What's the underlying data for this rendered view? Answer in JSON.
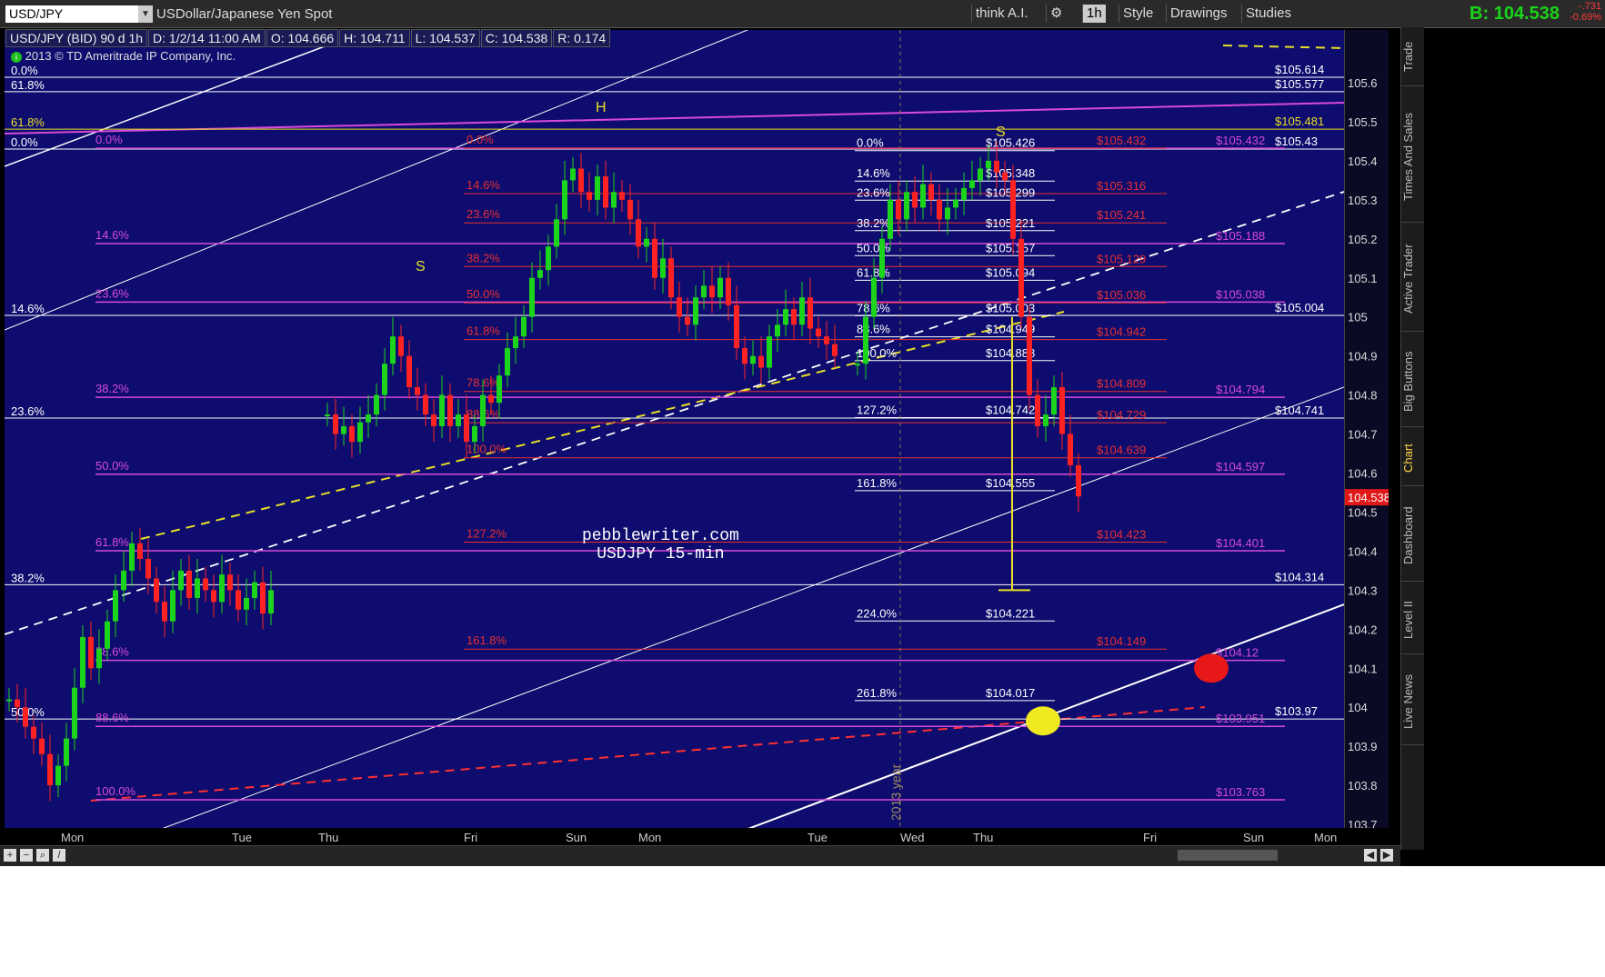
{
  "toolbar": {
    "symbol": "USD/JPY",
    "description": "USDollar/Japanese Yen Spot",
    "think_ai": "think A.I.",
    "aggregation": "1h",
    "style": "Style",
    "drawings": "Drawings",
    "studies": "Studies",
    "last_price_label": "B: 104.538",
    "change_1": "-.731",
    "change_2": "-0.69%"
  },
  "info": {
    "title": "USD/JPY (BID) 90 d 1h",
    "date": "D: 1/2/14 11:00 AM",
    "open": "O: 104.666",
    "high": "H: 104.711",
    "low": "L: 104.537",
    "close": "C: 104.538",
    "range": "R: 0.174"
  },
  "copyright": "2013 © TD Ameritrade IP Company, Inc.",
  "watermark": {
    "line1": "pebblewriter.com",
    "line2": "USDJPY 15-min"
  },
  "annotations": {
    "h": "H",
    "s_left": "S",
    "s_right": "S",
    "year": "2013 year"
  },
  "price_axis": [
    "105.6",
    "105.5",
    "105.4",
    "105.3",
    "105.2",
    "105.1",
    "105",
    "104.9",
    "104.8",
    "104.7",
    "104.6",
    "104.5",
    "104.4",
    "104.3",
    "104.2",
    "104.1",
    "104",
    "103.9",
    "103.8",
    "103.7"
  ],
  "current_price_tag": "104.538",
  "time_axis": [
    "Mon",
    "Tue",
    "Thu",
    "Fri",
    "Sun",
    "Mon",
    "Tue",
    "Wed",
    "Thu",
    "Fri",
    "Sun",
    "Mon"
  ],
  "fib_white_left": [
    "0.0%",
    "61.8%",
    "0.0%",
    "14.6%",
    "23.6%",
    "38.2%",
    "50.0%"
  ],
  "fib_yellow_left": [
    "61.8%"
  ],
  "fib_magenta": [
    "0.0%",
    "14.6%",
    "23.6%",
    "38.2%",
    "50.0%",
    "61.8%",
    "78.6%",
    "88.6%",
    "100.0%"
  ],
  "fib_red": [
    "0.0%",
    "14.6%",
    "23.6%",
    "38.2%",
    "50.0%",
    "61.8%",
    "78.6%",
    "88.6%",
    "100.0%",
    "127.2%",
    "161.8%"
  ],
  "fib_right_pct": [
    "0.0%",
    "14.6%",
    "23.6%",
    "38.2%",
    "50.0%",
    "61.8%",
    "78.6%",
    "88.6%",
    "100.0%",
    "127.2%",
    "161.8%",
    "224.0%",
    "261.8%"
  ],
  "fib_right_price": [
    "$105.426",
    "$105.348",
    "$105.299",
    "$105.221",
    "$105.157",
    "$105.094",
    "$105.003",
    "$104.949",
    "$104.888",
    "$104.742",
    "$104.555",
    "$104.221",
    "$104.017"
  ],
  "red_prices": [
    "$105.432",
    "$105.316",
    "$105.241",
    "$105.129",
    "$105.036",
    "$104.942",
    "$104.809",
    "$104.729",
    "$104.639",
    "$104.423",
    "$104.149"
  ],
  "magenta_prices": [
    "$105.432",
    "$105.188",
    "$105.038",
    "$104.794",
    "$104.597",
    "$104.401",
    "$104.12",
    "$103.951",
    "$103.763"
  ],
  "white_prices": [
    "$105.614",
    "$105.577",
    "$105.43",
    "$105.004",
    "$104.741",
    "$104.314",
    "$103.97"
  ],
  "yellow_prices": [
    "$105.481"
  ],
  "side_tabs": [
    "Trade",
    "Times And Sales",
    "Active Trader",
    "Big Buttons",
    "Chart",
    "Dashboard",
    "Level II",
    "Live News"
  ],
  "colors": {
    "bg": "#0e0c6e",
    "up": "#1bd41b",
    "down": "#ff2222",
    "magenta": "#d84ad8",
    "red_fib": "#e83030",
    "yellow": "#e8e028"
  }
}
